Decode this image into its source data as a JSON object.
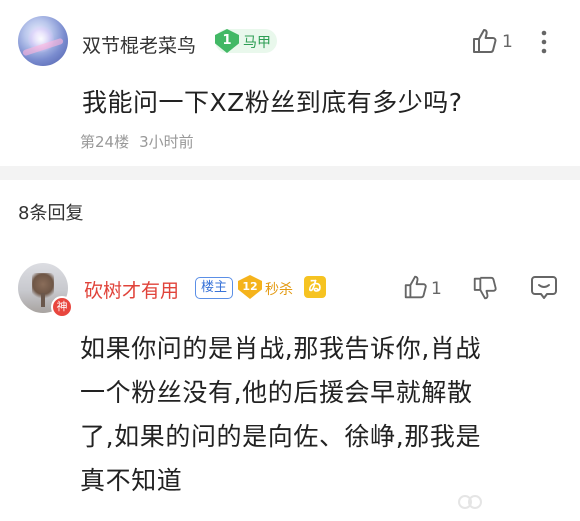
{
  "post": {
    "username": "双节棍老菜鸟",
    "level": "1",
    "level_name": "马甲",
    "like_count": "1",
    "text": "我能问一下XZ粉丝到底有多少吗?",
    "floor": "第24楼",
    "time": "3小时前"
  },
  "replies_header": "8条回复",
  "reply": {
    "username": "砍树才有用",
    "avatar_badge": "神",
    "tag": "楼主",
    "level": "12",
    "level_name": "秒杀",
    "membership_icon": "ゐ",
    "like_count": "1",
    "lines": [
      "如果你问的是肖战,那我告诉你,肖战",
      "一个粉丝没有,他的后援会早就解散",
      "了,如果的问的是向佐、徐峥,那我是",
      "真不知道"
    ]
  },
  "colors": {
    "reply_username": "#e0433a",
    "tag_border": "#5b8fe6",
    "level1_badge": "#42b865",
    "level12_badge": "#f5b31c"
  }
}
